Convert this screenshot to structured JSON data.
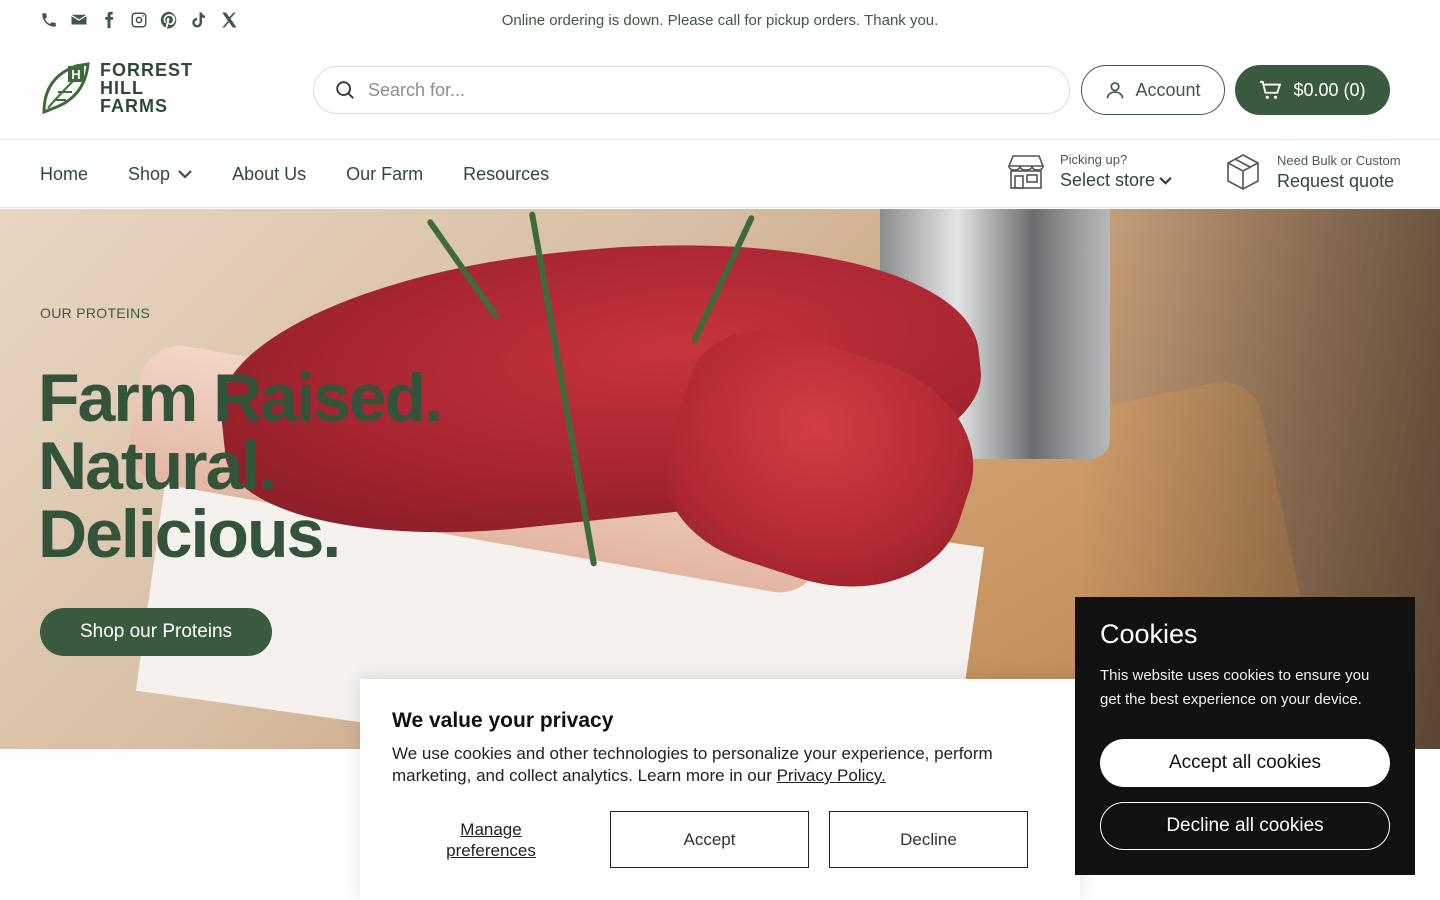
{
  "topbar": {
    "announcement": "Online ordering is down. Please call for pickup orders. Thank you.",
    "social_icons": [
      "phone-icon",
      "email-icon",
      "facebook-icon",
      "instagram-icon",
      "pinterest-icon",
      "tiktok-icon",
      "x-icon"
    ]
  },
  "header": {
    "logo_text": [
      "FORREST",
      "HILL",
      "FARMS"
    ],
    "logo_letter": "H",
    "search_placeholder": "Search for...",
    "account_label": "Account",
    "cart_label": "$0.00 (0)"
  },
  "nav": {
    "items": [
      {
        "label": "Home",
        "has_dropdown": false
      },
      {
        "label": "Shop",
        "has_dropdown": true
      },
      {
        "label": "About Us",
        "has_dropdown": false
      },
      {
        "label": "Our Farm",
        "has_dropdown": false
      },
      {
        "label": "Resources",
        "has_dropdown": false
      }
    ],
    "store": {
      "small": "Picking up?",
      "big": "Select store"
    },
    "quote": {
      "small": "Need Bulk or Custom",
      "big": "Request quote"
    }
  },
  "hero": {
    "eyebrow": "OUR PROTEINS",
    "title_lines": [
      "Farm Raised.",
      "Natural.",
      "Delicious."
    ],
    "button_label": "Shop our Proteins"
  },
  "privacy": {
    "title": "We value your privacy",
    "body": "We use cookies and other technologies to personalize your experience, perform marketing, and collect analytics. Learn more in our",
    "link": "Privacy Policy.",
    "manage_line1": "Manage",
    "manage_line2": "preferences",
    "accept": "Accept",
    "decline": "Decline"
  },
  "cookies": {
    "title": "Cookies",
    "body": "This website uses cookies to ensure you get the best experience on your device.",
    "accept_all": "Accept all cookies",
    "decline_all": "Decline all cookies"
  },
  "colors": {
    "brand_green": "#3a5a40",
    "text_green": "#2f4a34",
    "cookie_bg": "#111111"
  }
}
